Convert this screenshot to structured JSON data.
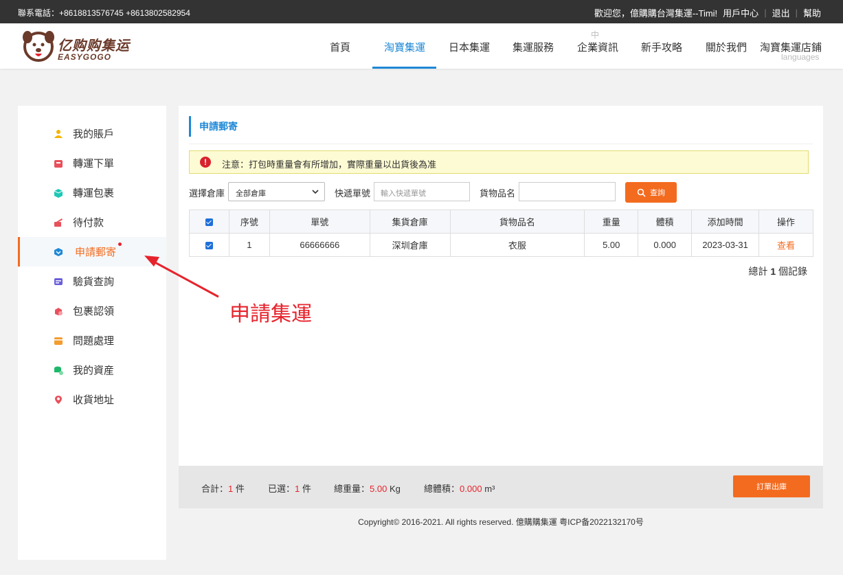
{
  "topbar": {
    "phone": "聯系電話：+8618813576745 +8613802582954",
    "welcome": "歡迎您，億購購台灣集運--Timi!",
    "user_center": "用戶中心",
    "logout": "退出",
    "help": "幫助"
  },
  "logo": {
    "cn": "亿购购集运",
    "en": "EASYGOGO"
  },
  "nav": {
    "items": [
      "首頁",
      "淘寶集運",
      "日本集運",
      "集運服務",
      "企業資訊",
      "新手攻略",
      "關於我們",
      "淘寶集運店鋪"
    ],
    "small_top": "中心",
    "small_bottom": "languages"
  },
  "sidebar": {
    "items": [
      {
        "label": "我的賬戶",
        "icon": "user-group-icon",
        "color": "#f5b400"
      },
      {
        "label": "轉運下單",
        "icon": "order-icon",
        "color": "#e8505b"
      },
      {
        "label": "轉運包裹",
        "icon": "box-icon",
        "color": "#1ec8b5"
      },
      {
        "label": "待付款",
        "icon": "payment-icon",
        "color": "#e8505b"
      },
      {
        "label": "申請郵寄",
        "icon": "mail-box-icon",
        "color": "#1e88d6"
      },
      {
        "label": "驗貨查詢",
        "icon": "inspect-icon",
        "color": "#6a5ed9"
      },
      {
        "label": "包裹認領",
        "icon": "claim-icon",
        "color": "#e8505b"
      },
      {
        "label": "問題處理",
        "icon": "issue-icon",
        "color": "#f39c2f"
      },
      {
        "label": "我的資産",
        "icon": "asset-icon",
        "color": "#1eb86b"
      },
      {
        "label": "收貨地址",
        "icon": "location-icon",
        "color": "#e8505b"
      }
    ]
  },
  "panel": {
    "title": "申請郵寄",
    "notice": "注意：打包時重量會有所增加，實際重量以出貨後為准",
    "filter": {
      "warehouse_label": "選擇倉庫",
      "warehouse_value": "全部倉庫",
      "tracking_label": "快遞單號",
      "tracking_placeholder": "輸入快遞單號",
      "goods_label": "貨物品名",
      "goods_placeholder": "",
      "search_button": "查詢"
    },
    "table": {
      "headers": [
        "序號",
        "單號",
        "集貨倉庫",
        "貨物品名",
        "重量",
        "體積",
        "添加時間",
        "操作"
      ],
      "rows": [
        {
          "index": "1",
          "number": "66666666",
          "warehouse": "深圳倉庫",
          "goods": "衣服",
          "weight": "5.00",
          "volume": "0.000",
          "added": "2023-03-31",
          "action": "查看"
        }
      ]
    },
    "total_prefix": "總計",
    "total_count": "1",
    "total_suffix": "個記錄"
  },
  "footer_bar": {
    "sum_label": "合計：",
    "sum_value": "1",
    "sum_unit": "件",
    "selected_label": "已選：",
    "selected_value": "1",
    "selected_unit": "件",
    "weight_label": "總重量：",
    "weight_value": "5.00",
    "weight_unit": "Kg",
    "volume_label": "總體積：",
    "volume_value": "0.000",
    "volume_unit": "m³",
    "checkout_button": "訂單出庫"
  },
  "copyright": "Copyright© 2016-2021. All rights reserved. 億購購集運 粤ICP备2022132170号",
  "annotation": {
    "text": "申請集運",
    "color": "#e6232c"
  },
  "colors": {
    "accent": "#f36b1f",
    "blue": "#1e88d6",
    "topbar": "#333333"
  }
}
